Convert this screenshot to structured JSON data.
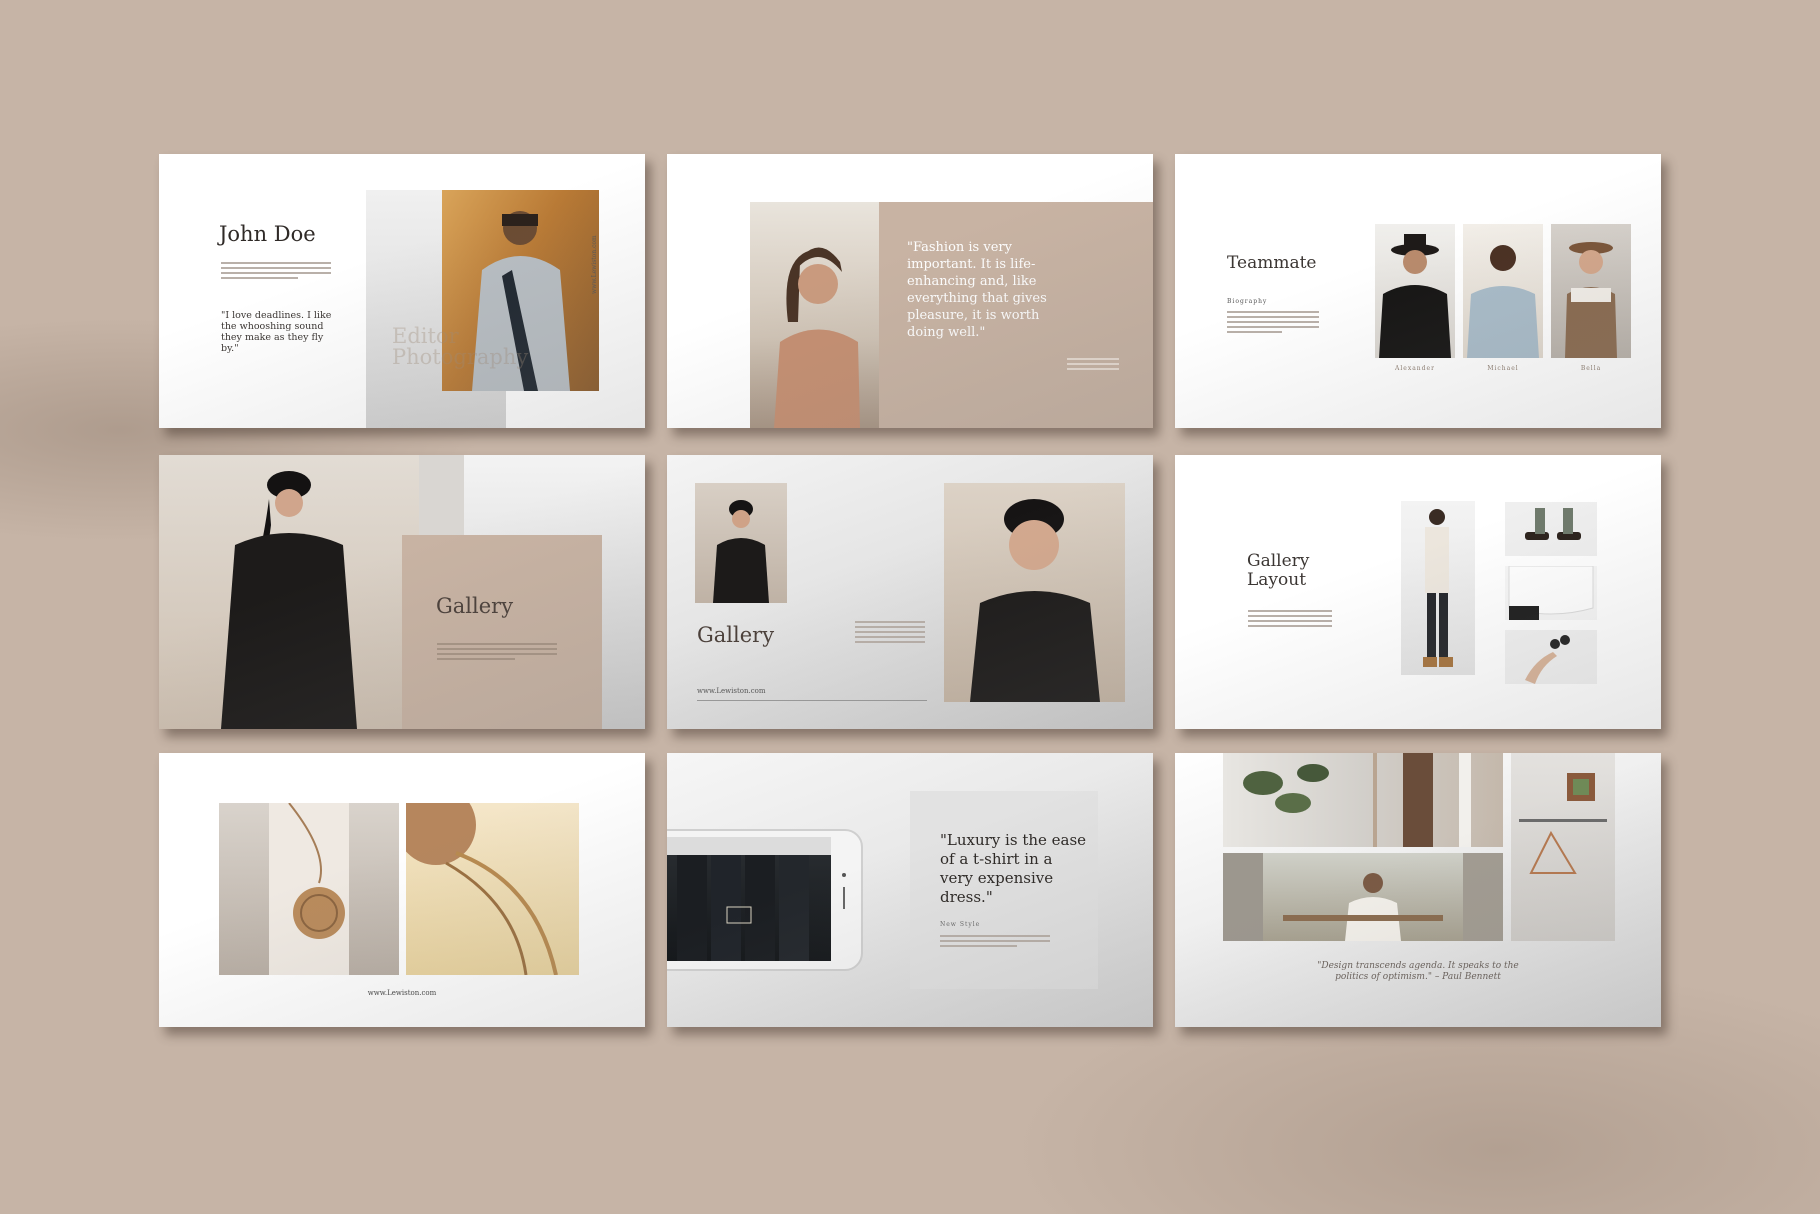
{
  "slides": {
    "s1": {
      "name": "John Doe",
      "quote": "\"I love deadlines. I like the whooshing sound they make as they fly by.\"",
      "faded_line1": "Editor",
      "faded_line2": "Photography",
      "vertical_url": "www.Lewiston.com"
    },
    "s2": {
      "quote": "\"Fashion is very important. It is life-enhancing and, like everything that gives pleasure, it is worth doing well.\""
    },
    "s3": {
      "title": "Teammate",
      "bio_label": "Biography",
      "members": [
        "Alexander",
        "Michael",
        "Bella"
      ]
    },
    "s4": {
      "title": "Gallery"
    },
    "s5": {
      "title": "Gallery",
      "url": "www.Lewiston.com"
    },
    "s6": {
      "title_line1": "Gallery",
      "title_line2": "Layout"
    },
    "s7": {
      "url": "www.Lewiston.com"
    },
    "s8": {
      "quote": "\"Luxury is the ease of a t-shirt in a very expensive dress.\"",
      "label": "New Style"
    },
    "s9": {
      "quote_line1": "\"Design transcends agenda. It speaks to the",
      "quote_line2": "politics of optimism.\" – Paul Bennett"
    }
  },
  "colors": {
    "background": "#c6b4a6",
    "beige": "#c8b3a3",
    "text_dark": "#3b3633"
  }
}
